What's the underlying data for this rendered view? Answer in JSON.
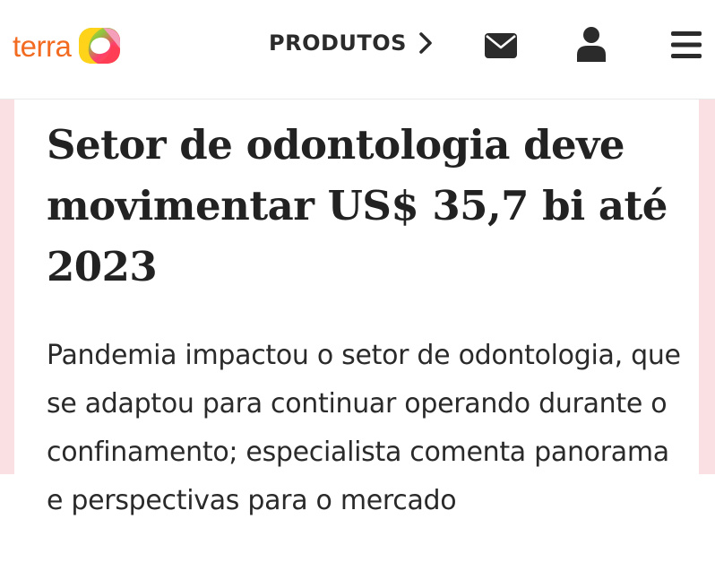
{
  "header": {
    "logo_text": "terra",
    "nav_label": "PRODUTOS",
    "icons": {
      "logo_mark": "terra-logo-icon",
      "chevron": "chevron-right-icon",
      "mail": "mail-icon",
      "user": "user-icon",
      "menu": "menu-icon"
    }
  },
  "article": {
    "headline": "Setor de odontologia deve movimentar US$ 35,7 bi até 2023",
    "subtitle": "Pandemia impactou o setor de odontologia, que se adaptou para continuar operando durante o confinamento; especialista comenta panorama e perspectivas para o mercado"
  },
  "colors": {
    "brand_orange": "#f26b21",
    "accent_pink": "#fbe0e3",
    "text_dark": "#222222"
  }
}
